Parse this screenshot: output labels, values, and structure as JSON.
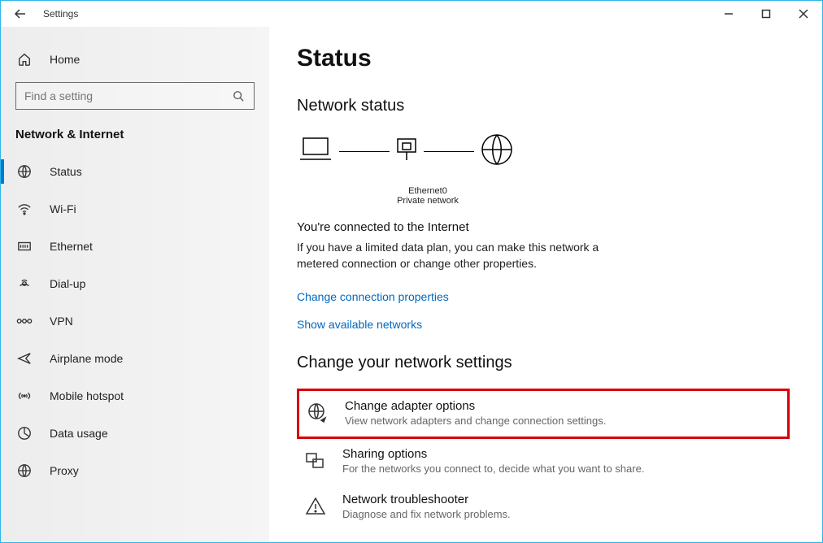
{
  "window": {
    "title": "Settings"
  },
  "sidebar": {
    "home_label": "Home",
    "search_placeholder": "Find a setting",
    "section_heading": "Network & Internet",
    "items": [
      {
        "label": "Status"
      },
      {
        "label": "Wi-Fi"
      },
      {
        "label": "Ethernet"
      },
      {
        "label": "Dial-up"
      },
      {
        "label": "VPN"
      },
      {
        "label": "Airplane mode"
      },
      {
        "label": "Mobile hotspot"
      },
      {
        "label": "Data usage"
      },
      {
        "label": "Proxy"
      }
    ]
  },
  "content": {
    "page_title": "Status",
    "network_status_heading": "Network status",
    "diagram_adapter": "Ethernet0",
    "diagram_network_type": "Private network",
    "connected_title": "You're connected to the Internet",
    "connected_desc": "If you have a limited data plan, you can make this network a metered connection or change other properties.",
    "link_change_props": "Change connection properties",
    "link_show_networks": "Show available networks",
    "change_settings_heading": "Change your network settings",
    "items": [
      {
        "title": "Change adapter options",
        "desc": "View network adapters and change connection settings."
      },
      {
        "title": "Sharing options",
        "desc": "For the networks you connect to, decide what you want to share."
      },
      {
        "title": "Network troubleshooter",
        "desc": "Diagnose and fix network problems."
      }
    ]
  }
}
